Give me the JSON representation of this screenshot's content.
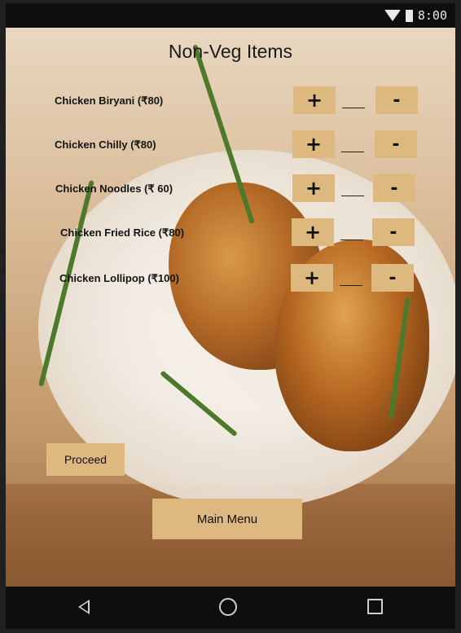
{
  "status_bar": {
    "time": "8:00",
    "icons": [
      "wifi-icon",
      "battery-icon"
    ]
  },
  "screen": {
    "title": "Non-Veg Items",
    "items": [
      {
        "label": "Chicken Biryani  (₹80)",
        "plus": "+",
        "minus": "-",
        "quantity": ""
      },
      {
        "label": "Chicken Chilly (₹80)",
        "plus": "+",
        "minus": "-",
        "quantity": ""
      },
      {
        "label": "Chicken Noodles  (₹ 60)",
        "plus": "+",
        "minus": "-",
        "quantity": ""
      },
      {
        "label": "Chicken Fried Rice  (₹80)",
        "plus": "+",
        "minus": "-",
        "quantity": ""
      },
      {
        "label": "Chicken Lollipop (₹100)",
        "plus": "+",
        "minus": "-",
        "quantity": ""
      }
    ],
    "proceed_label": "Proceed",
    "main_menu_label": "Main Menu"
  },
  "nav_bar": {
    "icons": [
      "back-icon",
      "home-icon",
      "recents-icon"
    ]
  },
  "colors": {
    "button_bg": "#ddb97f",
    "status_bar_bg": "#0e0e0e"
  }
}
